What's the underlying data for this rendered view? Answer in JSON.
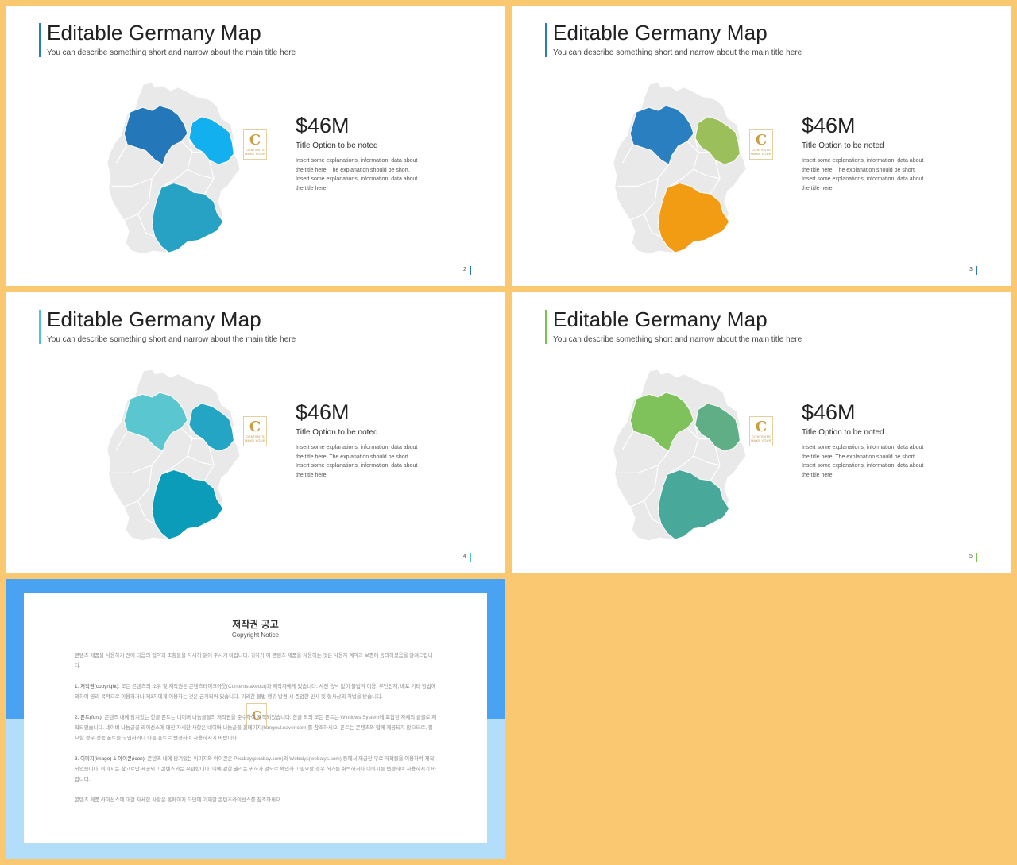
{
  "slides": [
    {
      "id": "s2",
      "title": "Editable Germany Map",
      "subtitle": "You can describe something short and narrow about the main title here",
      "price": "$46M",
      "option_title": "Title Option to be noted",
      "description": "Insert some explanations, information, data about the title here. The explanation should be short. Insert some explanations, information, data about the title here.",
      "page": "2",
      "accent": "#2b7bbf",
      "colors": {
        "lower_saxony": "#2478ba",
        "brandenburg": "#12b0ee",
        "bavaria": "#27a1c4",
        "base": "#e9e9e9"
      }
    },
    {
      "id": "s3",
      "title": "Editable Germany Map",
      "subtitle": "You can describe something short and narrow about the main title here",
      "price": "$46M",
      "option_title": "Title Option to be noted",
      "description": "Insert some explanations, information, data about the title here. The explanation should be short. Insert some explanations, information, data about the title here.",
      "page": "3",
      "accent": "#2b7bbf",
      "colors": {
        "lower_saxony": "#2a7fc0",
        "brandenburg": "#9bbf5a",
        "bavaria": "#f29c14",
        "base": "#e9e9e9"
      }
    },
    {
      "id": "s4",
      "title": "Editable Germany Map",
      "subtitle": "You can describe something short and narrow about the main title here",
      "price": "$46M",
      "option_title": "Title Option to be noted",
      "description": "Insert some explanations, information, data about the title here. The explanation should be short. Insert some explanations, information, data about the title here.",
      "page": "4",
      "accent": "#4fc2cf",
      "colors": {
        "lower_saxony": "#5ac6cf",
        "brandenburg": "#23a5c3",
        "bavaria": "#0b9cba",
        "base": "#e9e9e9"
      }
    },
    {
      "id": "s5",
      "title": "Editable Germany Map",
      "subtitle": "You can describe something short and narrow about the main title here",
      "price": "$46M",
      "option_title": "Title Option to be noted",
      "description": "Insert some explanations, information, data about the title here. The explanation should be short. Insert some explanations, information, data about the title here.",
      "page": "5",
      "accent": "#7cc04f",
      "colors": {
        "lower_saxony": "#7fc15b",
        "brandenburg": "#5fae86",
        "bavaria": "#48a89a",
        "base": "#e9e9e9"
      }
    }
  ],
  "logo": {
    "letter": "C",
    "text": "CONTENTS",
    "sub": "MAKE YOUR"
  },
  "copyright": {
    "title": "저작권 공고",
    "subtitle": "Copyright Notice",
    "intro": "콘텐츠 제품을 사용하기 전에 다음의 협약과 조항들을 자세히 읽어 주시기 바랍니다. 귀하가 이 콘텐츠 제품을 사용하는 것은 사용자 계약과 보증에 동의하셨음을 알려드립니다.",
    "p1_head": "1. 저작권(copyright):",
    "p1": "모든 콘텐츠의 소유 및 저작권은 콘텐츠테이크아웃(Contentstakeout)과 제작자에게 있습니다. 사전 승낙 없이 불법적 이용, 무단전재, 배포 기타 방법에 의하여 영리 목적으로 이용하거나 제3자에게 이용하는 것은 금지되어 있습니다. 이러한 불법 행위 발견 시 준엄한 민사 및 형사상의 처벌을 받습니다.",
    "p2_head": "2. 폰트(font):",
    "p2": "콘텐츠 내에 담겨있는 한글 폰트는 네이버 나눔글꼴의 저작권을 준수하여 제작되었습니다. 한글 외의 모든 폰트는 Windows System에 포함된 자체의 글꼴로 제작되었습니다. 네이버 나눔글꼴 라이선스에 대한 자세한 사항은 네이버 나눔글꼴 홈페이지(hangeul.naver.com)를 참조하세요. 폰트는 콘텐츠와 함께 제공되지 않으므로, 필요할 경우 정품 폰트를 구입하거나 다른 폰트로 변경하여 사용하시기 바랍니다.",
    "p3_head": "3. 이미지(image) & 아이콘(icon):",
    "p3": "콘텐츠 내에 담겨있는 이미지와 아이콘은 Pixabay(pixabay.com)와 Webalys(webalys.com) 등에서 제공한 무료 저작물을 이용하여 제작되었습니다. 이미지는 참고로만 제공되고 콘텐츠와는 무관합니다. 이에 관한 권리는 귀하가 별도로 확인하고 필요할 경우 허가를 취득하거나 이미지를 변경하여 사용하시기 바랍니다.",
    "footer": "콘텐츠 제품 라이선스에 대한 자세한 사항은 홈페이지 하단에 기재한 콘텐츠라이선스를 참조하세요."
  }
}
